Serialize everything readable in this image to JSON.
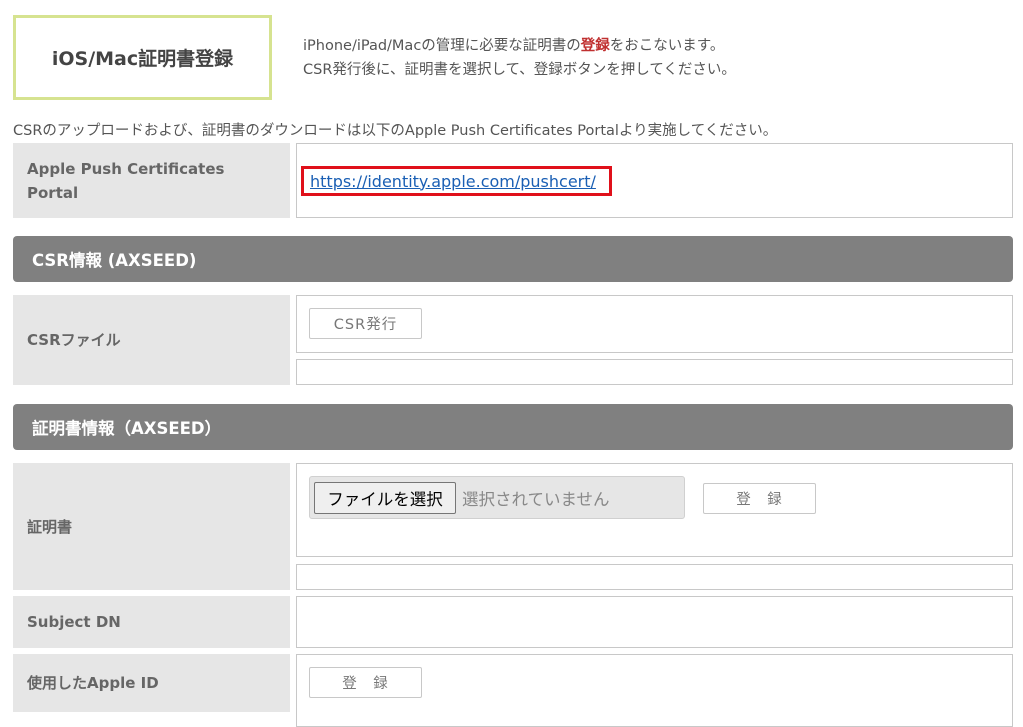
{
  "header": {
    "title": "iOS/Mac証明書登録",
    "desc_line1_pre": "iPhone/iPad/Macの管理に必要な証明書の",
    "desc_line1_highlight": "登録",
    "desc_line1_post": "をおこないます。",
    "desc_line2": "CSR発行後に、証明書を選択して、登録ボタンを押してください。"
  },
  "note": "CSRのアップロードおよび、証明書のダウンロードは以下のApple Push Certificates Portalより実施してください。",
  "portal": {
    "label_line1": "Apple Push Certificates",
    "label_line2": "Portal",
    "url": "https://identity.apple.com/pushcert/"
  },
  "csr_section": {
    "title": "CSR情報 (AXSEED)",
    "file_label": "CSRファイル",
    "issue_button": "CSR発行"
  },
  "cert_section": {
    "title": "証明書情報（AXSEED）",
    "cert_label": "証明書",
    "choose_file_button": "ファイルを選択",
    "no_file_text": "選択されていません",
    "register_button": "登　録",
    "subject_dn_label": "Subject DN",
    "apple_id_label": "使用したApple ID",
    "apple_id_register_button": "登　録"
  },
  "colors": {
    "title_border": "#d6e390",
    "section_bg": "#808080",
    "label_bg": "#e6e6e6",
    "highlight_box": "#e0101a",
    "link": "#1a5fb4"
  }
}
